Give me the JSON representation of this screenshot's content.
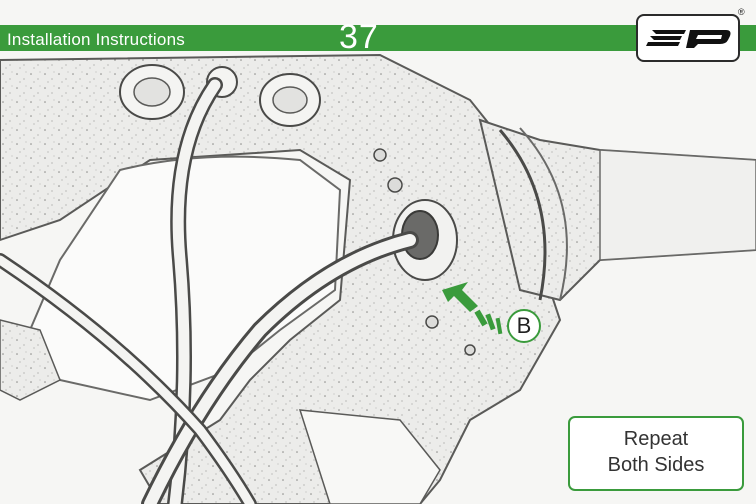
{
  "header": {
    "title": "Installation Instructions",
    "page_number": "37",
    "accent_color": "#3a9b3c",
    "registered_mark": "®"
  },
  "logo": {
    "name": "ep-logo",
    "text": "ep"
  },
  "callout": {
    "label": "B",
    "icon": "arrow-icon"
  },
  "note": {
    "line1": "Repeat",
    "line2": "Both Sides"
  }
}
